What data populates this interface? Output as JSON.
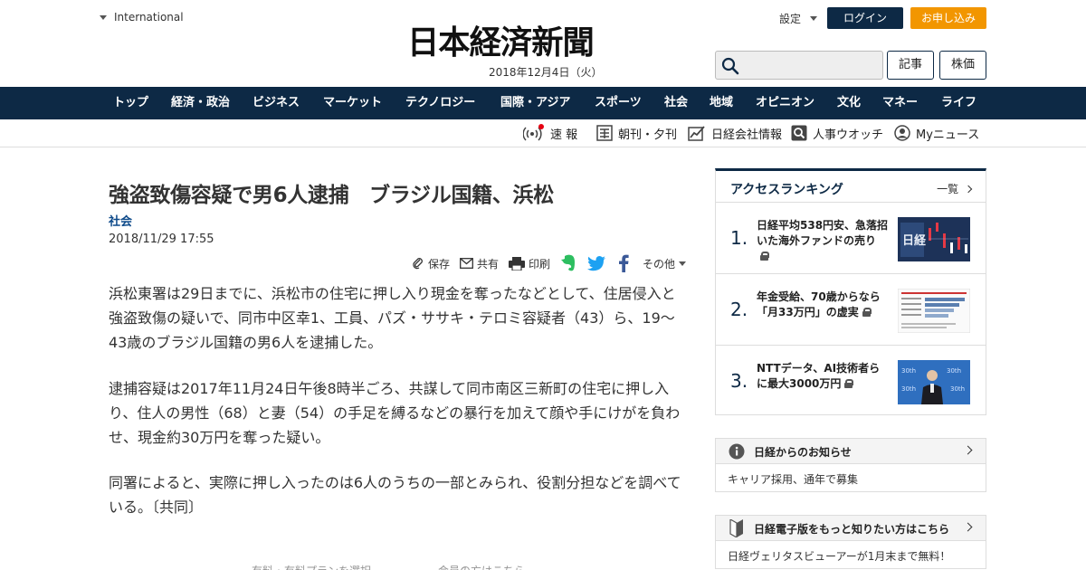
{
  "header": {
    "edition": "International",
    "logo": "日本経済新聞",
    "date": "2018年12月4日（火）",
    "settings": "設定",
    "login": "ログイン",
    "subscribe": "お申し込み",
    "search_placeholder": "",
    "articles_button": "記事",
    "stocks_button": "株価"
  },
  "nav": {
    "items": [
      "トップ",
      "経済・政治",
      "ビジネス",
      "マーケット",
      "テクノロジー",
      "国際・アジア",
      "スポーツ",
      "社会",
      "地域",
      "オピニオン",
      "文化",
      "マネー",
      "ライフ"
    ]
  },
  "subnav": {
    "breaking": "速 報",
    "edition_paper": "朝刊・夕刊",
    "company_info": "日経会社情報",
    "personnel": "人事ウオッチ",
    "my_news": "Myニュース"
  },
  "article": {
    "title": "強盗致傷容疑で男6人逮捕　ブラジル国籍、浜松",
    "category": "社会",
    "date": "2018/11/29 17:55",
    "share": {
      "save": "保存",
      "share": "共有",
      "print": "印刷",
      "other": "その他"
    },
    "paragraphs": [
      "浜松東署は29日までに、浜松市の住宅に押し入り現金を奪ったなどとして、住居侵入と強盗致傷の疑いで、同市中区幸1、工員、パズ・ササキ・テロミ容疑者（43）ら、19～43歳のブラジル国籍の男6人を逮捕した。",
      "逮捕容疑は2017年11月24日午後8時半ごろ、共謀して同市南区三新町の住宅に押し入り、住人の男性（68）と妻（54）の手足を縛るなどの暴行を加えて顔や手にけがを負わせ、現金約30万円を奪った疑い。",
      "同署によると、実際に押し入ったのは6人のうちの一部とみられ、役割分担などを調べている。〔共同〕"
    ],
    "footer_left": "有料・有料プランを選択",
    "footer_right": "会員の方はこちら"
  },
  "ranking": {
    "title": "アクセスランキング",
    "more": "一覧",
    "items": [
      {
        "rank": "1.",
        "text": "日経平均538円安、急落招いた海外ファンドの売り"
      },
      {
        "rank": "2.",
        "text": "年金受給、70歳からなら「月33万円」の虚実"
      },
      {
        "rank": "3.",
        "text": "NTTデータ、AI技術者らに最大3000万円"
      }
    ]
  },
  "notices": [
    {
      "title": "日経からのお知らせ",
      "body": "キャリア採用、通年で募集"
    },
    {
      "title": "日経電子版をもっと知りたい方はこちら",
      "body": "日経ヴェリタスビューアーが1月末まで無料！"
    }
  ],
  "colors": {
    "navy": "#0d2945",
    "orange": "#f29600",
    "category_blue": "#0d4a8a",
    "alert_red": "#e60012",
    "evernote_green": "#2dbe60",
    "twitter_blue": "#1da1f2",
    "facebook_blue": "#3b5998"
  }
}
